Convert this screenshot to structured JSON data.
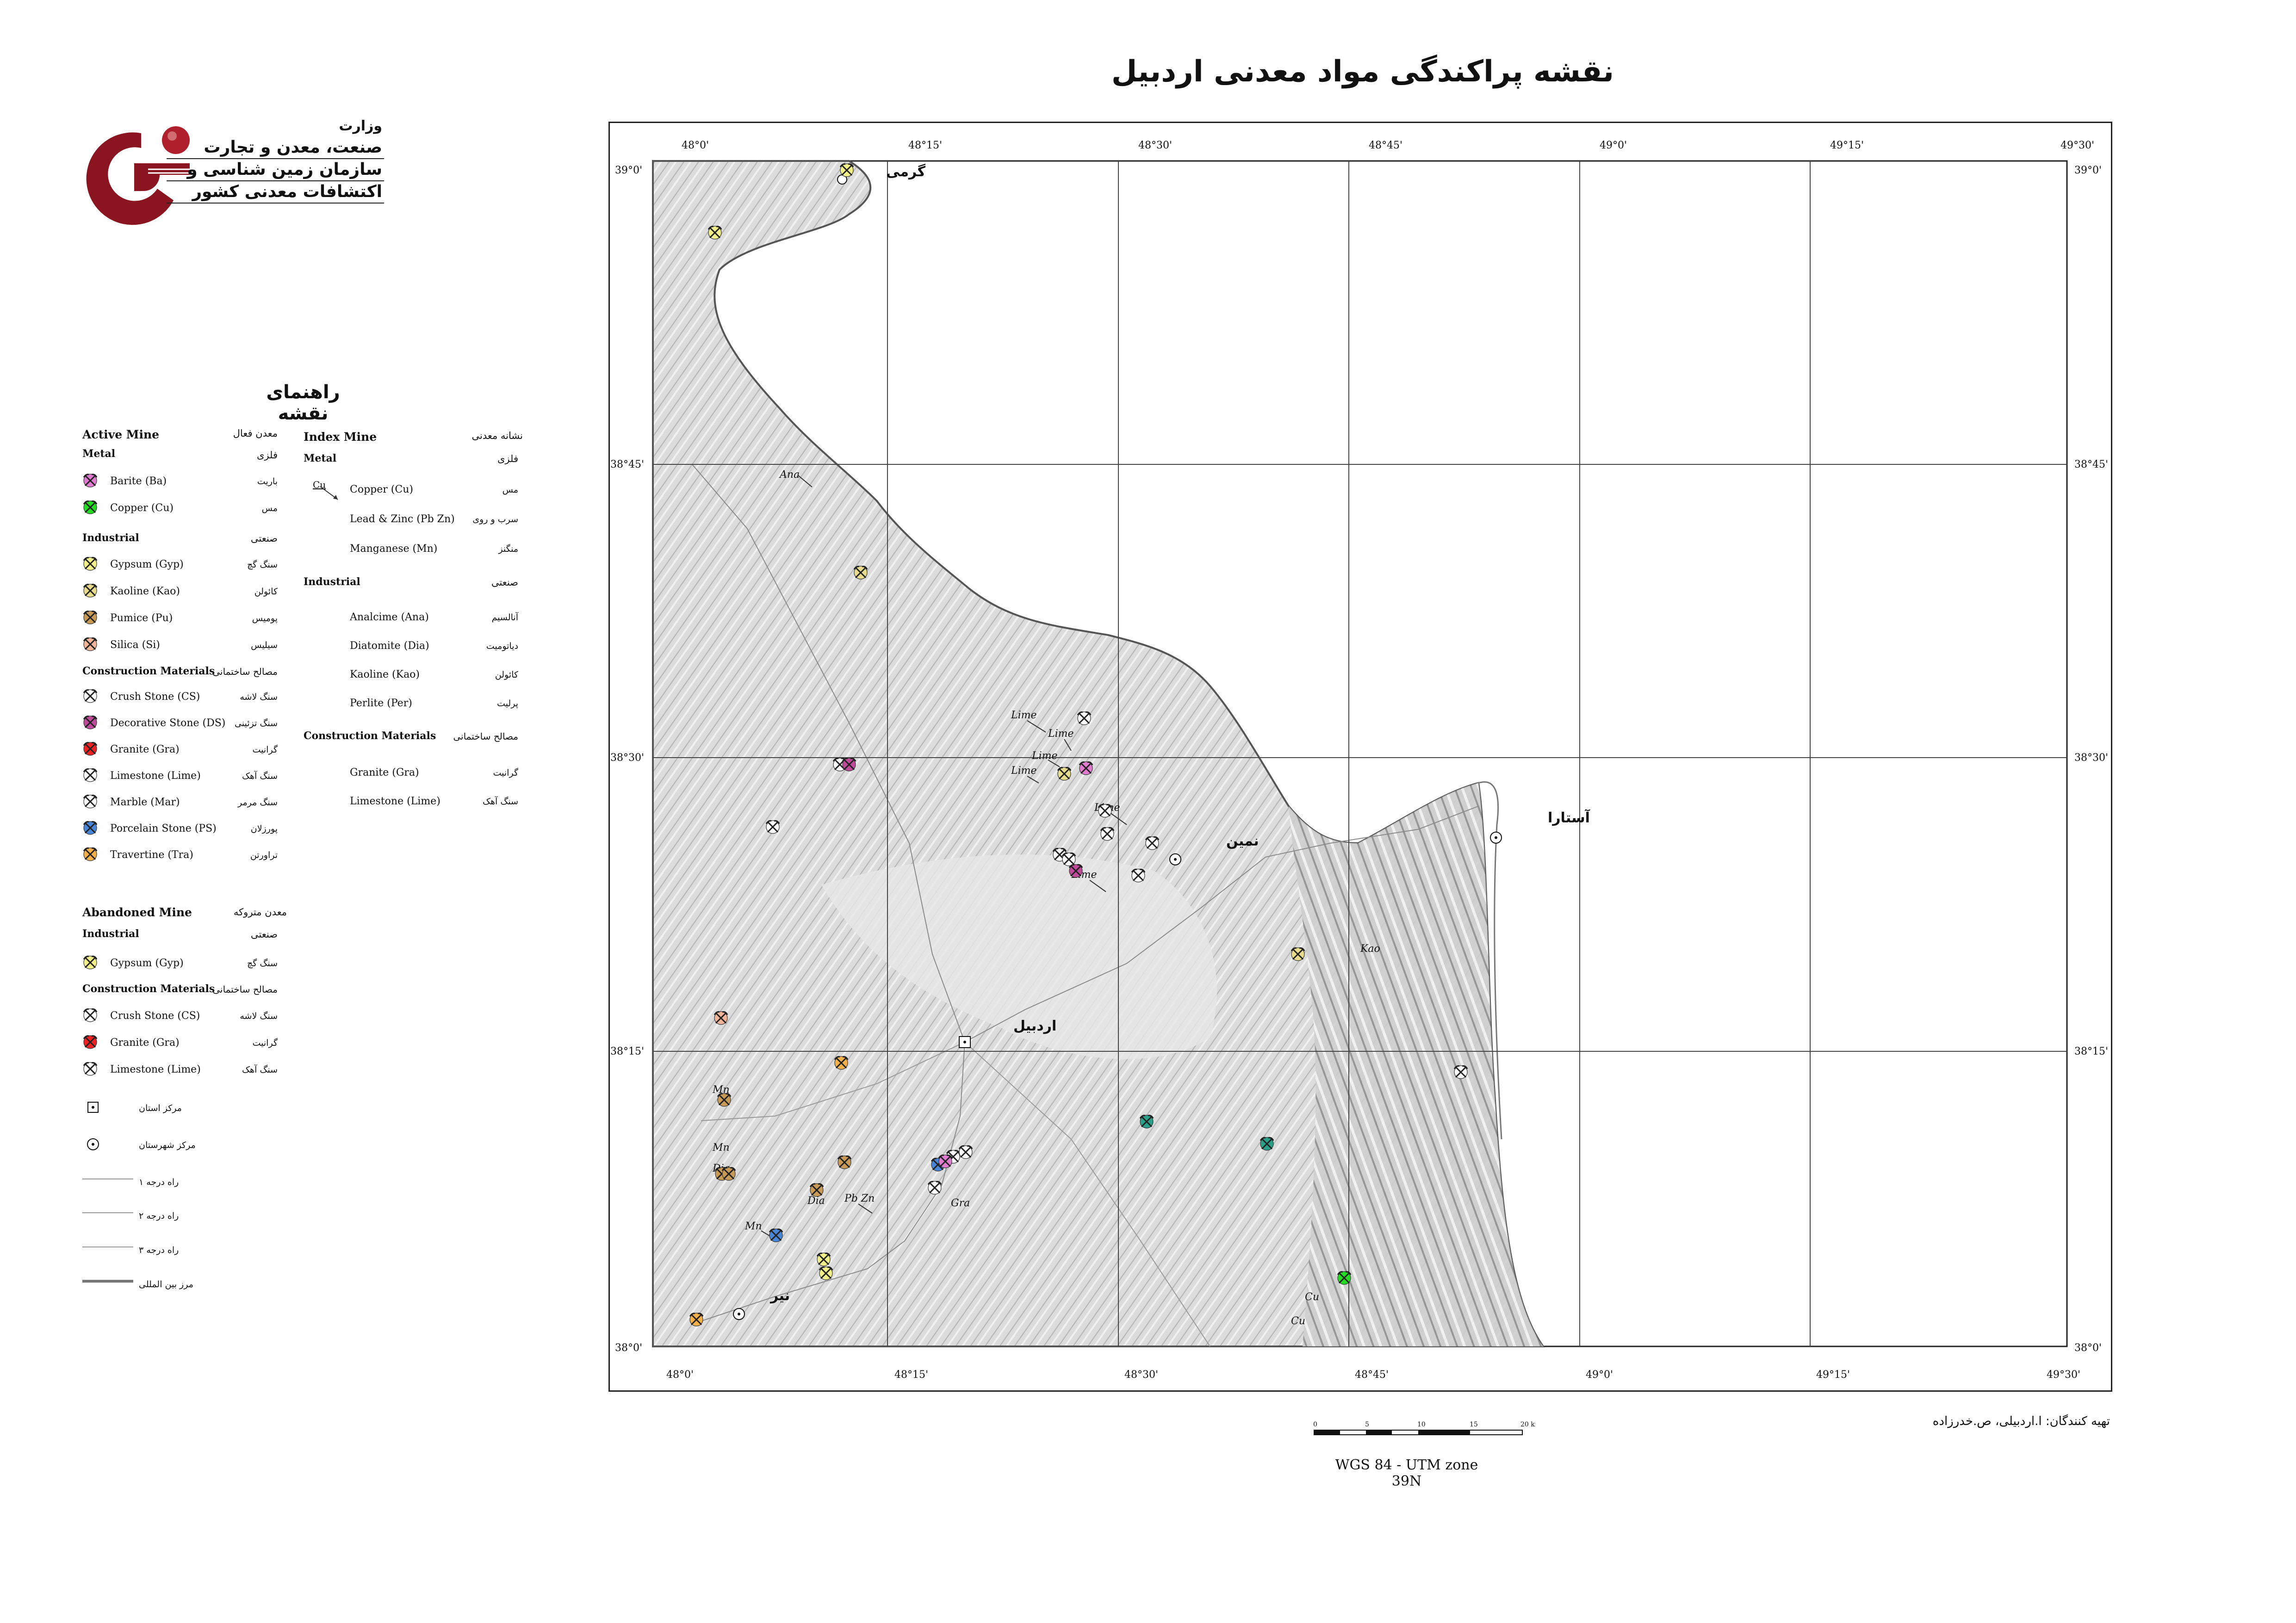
{
  "title": "نقشه پراکندگی مواد معدنی اردبیل",
  "organization": {
    "line1": "وزارت",
    "line2": "صنعت، معدن و تجارت",
    "line3": "سازمان زمین شناسی و",
    "line4": "اکتشافات معدنی کشور"
  },
  "legend": {
    "title": "راهنمای نقشه",
    "active": {
      "heading_en": "Active Mine",
      "heading_fa": "معدن فعال",
      "metal_en": "Metal",
      "metal_fa": "فلزی",
      "metal_items": [
        {
          "en": "Barite (Ba)",
          "fa": "باریت",
          "color": "#e07bd0"
        },
        {
          "en": "Copper (Cu)",
          "fa": "مس",
          "color": "#22dd22"
        }
      ],
      "industrial_en": "Industrial",
      "industrial_fa": "صنعتی",
      "industrial_items": [
        {
          "en": "Gypsum (Gyp)",
          "fa": "سنگ گچ",
          "color": "#f3f08a"
        },
        {
          "en": "Kaoline (Kao)",
          "fa": "کائولن",
          "color": "#e8dc8c"
        },
        {
          "en": "Pumice (Pu)",
          "fa": "پومیس",
          "color": "#c89a55"
        },
        {
          "en": "Silica (Si)",
          "fa": "سیلیس",
          "color": "#f2b59a"
        }
      ],
      "construction_en": "Construction Materials",
      "construction_fa": "مصالح ساختمانی",
      "construction_items": [
        {
          "en": "Crush Stone (CS)",
          "fa": "سنگ لاشه",
          "color": "#ffffff"
        },
        {
          "en": "Decorative Stone (DS)",
          "fa": "سنگ تزئینی",
          "color": "#c04a9a"
        },
        {
          "en": "Granite (Gra)",
          "fa": "گرانیت",
          "color": "#ee2222"
        },
        {
          "en": "Limestone (Lime)",
          "fa": "سنگ آهک",
          "color": "#ffffff"
        },
        {
          "en": "Marble (Mar)",
          "fa": "سنگ مرمر",
          "color": "#ffffff"
        },
        {
          "en": "Porcelain Stone (PS)",
          "fa": "پورزلان",
          "color": "#4a86d8"
        },
        {
          "en": "Travertine (Tra)",
          "fa": "تراورتن",
          "color": "#f5b04a"
        }
      ]
    },
    "abandoned": {
      "heading_en": "Abandoned Mine",
      "heading_fa": "معدن متروکه",
      "industrial_en": "Industrial",
      "industrial_fa": "صنعتی",
      "industrial_items": [
        {
          "en": "Gypsum (Gyp)",
          "fa": "سنگ گچ",
          "color": "#f3f08a"
        }
      ],
      "construction_en": "Construction Materials",
      "construction_fa": "مصالح ساختمانی",
      "construction_items": [
        {
          "en": "Crush Stone (CS)",
          "fa": "سنگ لاشه",
          "color": "#ffffff"
        },
        {
          "en": "Granite (Gra)",
          "fa": "گرانیت",
          "color": "#ee2222"
        },
        {
          "en": "Limestone (Lime)",
          "fa": "سنگ آهک",
          "color": "#ffffff"
        }
      ]
    },
    "index": {
      "heading_en": "Index Mine",
      "heading_fa": "نشانه معدنی",
      "metal_en": "Metal",
      "metal_fa": "فلزی",
      "metal_sample": "Cu",
      "metal_items": [
        {
          "en": "Copper (Cu)",
          "fa": "مس"
        },
        {
          "en": "Lead & Zinc (Pb Zn)",
          "fa": "سرب و روی"
        },
        {
          "en": "Manganese (Mn)",
          "fa": "منگنز"
        }
      ],
      "industrial_en": "Industrial",
      "industrial_fa": "صنعتی",
      "industrial_items": [
        {
          "en": "Analcime (Ana)",
          "fa": "آنالسیم"
        },
        {
          "en": "Diatomite (Dia)",
          "fa": "دیاتومیت"
        },
        {
          "en": "Kaoline (Kao)",
          "fa": "کائولن"
        },
        {
          "en": "Perlite (Per)",
          "fa": "پرلیت"
        }
      ],
      "construction_en": "Construction Materials",
      "construction_fa": "مصالح ساختمانی",
      "construction_items": [
        {
          "en": "Granite (Gra)",
          "fa": "گرانیت"
        },
        {
          "en": "Limestone (Lime)",
          "fa": "سنگ آهک"
        }
      ]
    },
    "misc": [
      {
        "fa": "مرکز استان",
        "symbol": "square-dot"
      },
      {
        "fa": "مرکز شهرستان",
        "symbol": "circle-dot"
      },
      {
        "fa": "راه درجه ۱",
        "symbol": "road-1"
      },
      {
        "fa": "راه درجه ۲",
        "symbol": "road-2"
      },
      {
        "fa": "راه درجه ۳",
        "symbol": "road-3"
      },
      {
        "fa": "مرز بین المللی",
        "symbol": "border"
      }
    ]
  },
  "map": {
    "lon_labels": [
      "48°0'",
      "48°15'",
      "48°30'",
      "48°45'",
      "49°0'",
      "49°15'",
      "49°30'"
    ],
    "lat_labels": [
      "39°0'",
      "38°45'",
      "38°30'",
      "38°15'",
      "38°0'"
    ],
    "cities": [
      {
        "name": "اردبیل",
        "type": "province-center"
      },
      {
        "name": "آستارا",
        "type": "county-center"
      },
      {
        "name": "نمین",
        "type": "county-center"
      },
      {
        "name": "نیر",
        "type": "county-center"
      },
      {
        "name": "گرمی",
        "type": "county-center"
      }
    ],
    "index_labels": [
      "Ana",
      "Lime",
      "Lime",
      "Lime",
      "Lime",
      "Lime",
      "Lime",
      "Kao",
      "Mn",
      "Mn",
      "Mn",
      "Dia",
      "Dia",
      "Pb Zn",
      "Gra",
      "Cu",
      "Cu"
    ]
  },
  "credit": "تهیه کنندگان: ا.اردبیلی، ص.خدرزاده",
  "scale": {
    "ticks": [
      "0",
      "5",
      "10",
      "15",
      "20 km"
    ]
  },
  "projection": "WGS 84 - UTM zone 39N"
}
